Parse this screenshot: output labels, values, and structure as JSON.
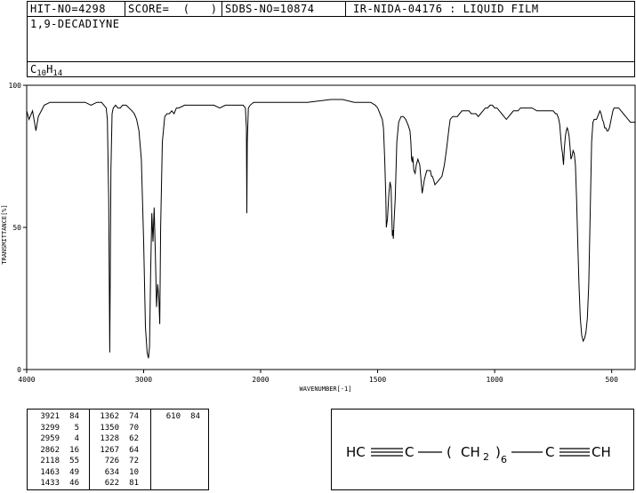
{
  "header": {
    "hit_no": "HIT-NO=4298",
    "score": "SCORE=  (   )",
    "sdbs_no": "SDBS-NO=10874",
    "ir_info": "IR-NIDA-04176 : LIQUID FILM",
    "compound": "1,9-DECADIYNE",
    "formula_c": "C",
    "formula_c_n": "10",
    "formula_h": "H",
    "formula_h_n": "14"
  },
  "chart_data": {
    "type": "line",
    "xlabel": "WAVENUMBER[-1]",
    "ylabel": "TRANSMITTANCE[%]",
    "xlim": [
      4000,
      400
    ],
    "ylim": [
      0,
      100
    ],
    "x_ticks": [
      4000,
      3000,
      2000,
      1500,
      1000,
      500
    ],
    "y_ticks": [
      0,
      50,
      100
    ],
    "series": [
      {
        "x": [
          4000,
          3980,
          3950,
          3921,
          3900,
          3850,
          3800,
          3700,
          3600,
          3500,
          3450,
          3400,
          3380,
          3360,
          3340,
          3320,
          3310,
          3299,
          3290,
          3280,
          3270,
          3260,
          3240,
          3220,
          3200,
          3180,
          3150,
          3100,
          3080,
          3060,
          3040,
          3020,
          3000,
          2985,
          2970,
          2959,
          2950,
          2940,
          2930,
          2920,
          2910,
          2900,
          2890,
          2880,
          2870,
          2862,
          2855,
          2840,
          2820,
          2800,
          2780,
          2760,
          2740,
          2720,
          2700,
          2650,
          2600,
          2550,
          2500,
          2450,
          2400,
          2350,
          2300,
          2250,
          2200,
          2150,
          2130,
          2122,
          2118,
          2114,
          2105,
          2090,
          2060,
          2000,
          1900,
          1800,
          1700,
          1650,
          1600,
          1560,
          1530,
          1510,
          1500,
          1490,
          1480,
          1475,
          1470,
          1465,
          1463,
          1458,
          1452,
          1447,
          1443,
          1440,
          1437,
          1435,
          1433,
          1430,
          1425,
          1418,
          1410,
          1400,
          1390,
          1380,
          1370,
          1362,
          1358,
          1355,
          1352,
          1350,
          1345,
          1340,
          1335,
          1328,
          1320,
          1310,
          1300,
          1290,
          1280,
          1275,
          1270,
          1267,
          1262,
          1255,
          1245,
          1235,
          1225,
          1215,
          1205,
          1195,
          1190,
          1180,
          1170,
          1160,
          1150,
          1140,
          1130,
          1120,
          1110,
          1100,
          1090,
          1080,
          1070,
          1060,
          1050,
          1040,
          1030,
          1020,
          1010,
          1000,
          990,
          980,
          970,
          960,
          950,
          940,
          930,
          920,
          910,
          900,
          890,
          880,
          870,
          860,
          850,
          840,
          820,
          800,
          790,
          780,
          770,
          760,
          750,
          740,
          735,
          730,
          726,
          722,
          718,
          714,
          710,
          706,
          702,
          698,
          694,
          690,
          686,
          682,
          678,
          674,
          670,
          665,
          660,
          655,
          650,
          645,
          640,
          634,
          628,
          622,
          616,
          610,
          604,
          598,
          592,
          586,
          580,
          575,
          570,
          565,
          560,
          555,
          550,
          545,
          540,
          535,
          530,
          525,
          520,
          515,
          510,
          505,
          500,
          495,
          490,
          485,
          480,
          470,
          460,
          450,
          440,
          430,
          420,
          410,
          400
        ],
        "y": [
          91,
          88,
          91,
          84,
          89,
          93,
          94,
          94,
          94,
          94,
          93,
          94,
          94,
          94,
          93,
          92,
          88,
          60,
          6,
          70,
          90,
          92,
          93,
          92,
          92,
          93,
          93,
          91,
          90,
          88,
          84,
          74,
          45,
          15,
          6,
          4,
          8,
          35,
          55,
          45,
          57,
          40,
          22,
          30,
          25,
          16,
          50,
          80,
          89,
          90,
          90,
          91,
          90,
          92,
          92,
          93,
          93,
          93,
          93,
          93,
          93,
          92,
          93,
          93,
          93,
          93,
          92,
          85,
          55,
          80,
          92,
          93,
          94,
          94,
          94,
          94,
          95,
          95,
          94,
          94,
          94,
          93,
          92,
          90,
          88,
          85,
          74,
          60,
          50,
          53,
          62,
          66,
          64,
          55,
          47,
          49,
          46,
          52,
          60,
          80,
          87,
          89,
          89,
          88,
          86,
          84,
          80,
          74,
          73,
          75,
          70,
          69,
          72,
          74,
          72,
          62,
          67,
          70,
          70,
          70,
          68,
          68,
          67,
          65,
          66,
          67,
          68,
          72,
          78,
          85,
          88,
          89,
          89,
          89,
          90,
          91,
          91,
          91,
          91,
          90,
          90,
          90,
          89,
          90,
          91,
          92,
          92,
          93,
          93,
          92,
          92,
          91,
          90,
          89,
          88,
          89,
          90,
          91,
          91,
          91,
          92,
          92,
          92,
          92,
          92,
          92,
          91,
          91,
          91,
          91,
          91,
          91,
          91,
          90,
          90,
          89,
          88,
          86,
          82,
          78,
          76,
          72,
          78,
          82,
          84,
          85,
          84,
          82,
          78,
          74,
          75,
          77,
          76,
          72,
          60,
          45,
          30,
          18,
          12,
          10,
          11,
          13,
          18,
          30,
          55,
          80,
          87,
          88,
          88,
          88,
          89,
          90,
          91,
          90,
          88,
          87,
          85,
          85,
          84,
          84,
          85,
          87,
          89,
          91,
          92,
          92,
          92,
          92,
          91,
          90,
          89,
          88,
          87,
          87,
          87
        ],
        "name": ""
      }
    ],
    "grid": false
  },
  "peaks": {
    "rows": [
      [
        "3921",
        "84",
        "1362",
        "74",
        "610",
        "84"
      ],
      [
        "3299",
        "5",
        "1350",
        "70",
        "",
        ""
      ],
      [
        "2959",
        "4",
        "1328",
        "62",
        "",
        ""
      ],
      [
        "2862",
        "16",
        "1267",
        "64",
        "",
        ""
      ],
      [
        "2118",
        "55",
        "726",
        "72",
        "",
        ""
      ],
      [
        "1463",
        "49",
        "634",
        "10",
        "",
        ""
      ],
      [
        "1433",
        "46",
        "622",
        "81",
        "",
        ""
      ]
    ]
  },
  "structure": {
    "left": "HC",
    "c": "C",
    "paren_open": "(",
    "ch": "CH",
    "sub2": "2",
    "paren_close": ")",
    "sub6": "6",
    "right": "CH"
  }
}
